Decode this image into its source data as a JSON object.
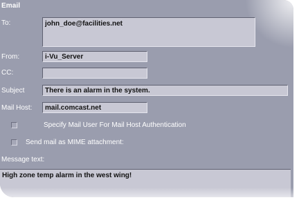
{
  "title": "Email",
  "fields": {
    "to": {
      "label": "To:",
      "value": "john_doe@facilities.net"
    },
    "from": {
      "label": "From:",
      "value": "i-Vu_Server"
    },
    "cc": {
      "label": "CC:",
      "value": ""
    },
    "subject": {
      "label": "Subject",
      "value": "There is an alarm in the system."
    },
    "mailhost": {
      "label": "Mail Host:",
      "value": "mail.comcast.net"
    }
  },
  "options": {
    "auth_label": "Specify Mail User For Mail Host Authentication",
    "auth_checked": false,
    "mime_label": "Send mail as MIME attachment:",
    "mime_checked": false
  },
  "message": {
    "label": "Message text:",
    "value": "High zone temp alarm in the west wing!"
  }
}
